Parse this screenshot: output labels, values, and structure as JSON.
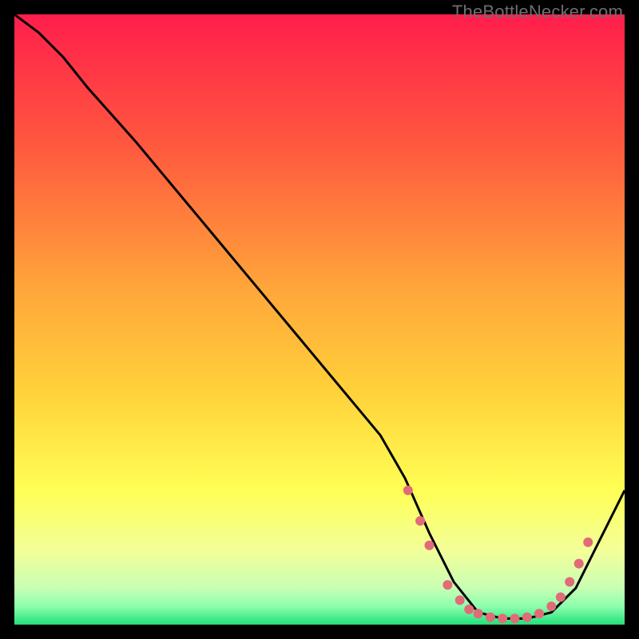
{
  "watermark": "TheBottleNecker.com",
  "colors": {
    "bg_black": "#000000",
    "grad_top": "#ff1e4c",
    "grad_mid1": "#ff7a3a",
    "grad_mid2": "#ffd23a",
    "grad_mid3": "#ffff66",
    "grad_mid4": "#e8ffb0",
    "grad_bottom": "#00e676",
    "curve": "#000000",
    "dots": "#e26b78"
  },
  "chart_data": {
    "type": "line",
    "title": "",
    "xlabel": "",
    "ylabel": "",
    "xlim": [
      0,
      100
    ],
    "ylim": [
      0,
      100
    ],
    "series": [
      {
        "name": "bottleneck-curve",
        "x": [
          0,
          4,
          8,
          12,
          20,
          30,
          40,
          50,
          60,
          64,
          68,
          72,
          76,
          80,
          84,
          88,
          92,
          96,
          100
        ],
        "y": [
          100,
          97,
          93,
          88,
          79,
          67,
          55,
          43,
          31,
          24,
          15,
          7,
          2,
          1,
          1,
          2,
          6,
          14,
          22
        ]
      }
    ],
    "markers": {
      "name": "highlighted-points",
      "x": [
        64.5,
        66.5,
        68.0,
        71.0,
        73.0,
        74.5,
        76.0,
        78.0,
        80.0,
        82.0,
        84.0,
        86.0,
        88.0,
        89.5,
        91.0,
        92.5,
        94.0
      ],
      "y": [
        22.0,
        17.0,
        13.0,
        6.5,
        4.0,
        2.5,
        1.8,
        1.2,
        1.0,
        1.0,
        1.2,
        1.8,
        3.0,
        4.5,
        7.0,
        10.0,
        13.5
      ]
    }
  }
}
